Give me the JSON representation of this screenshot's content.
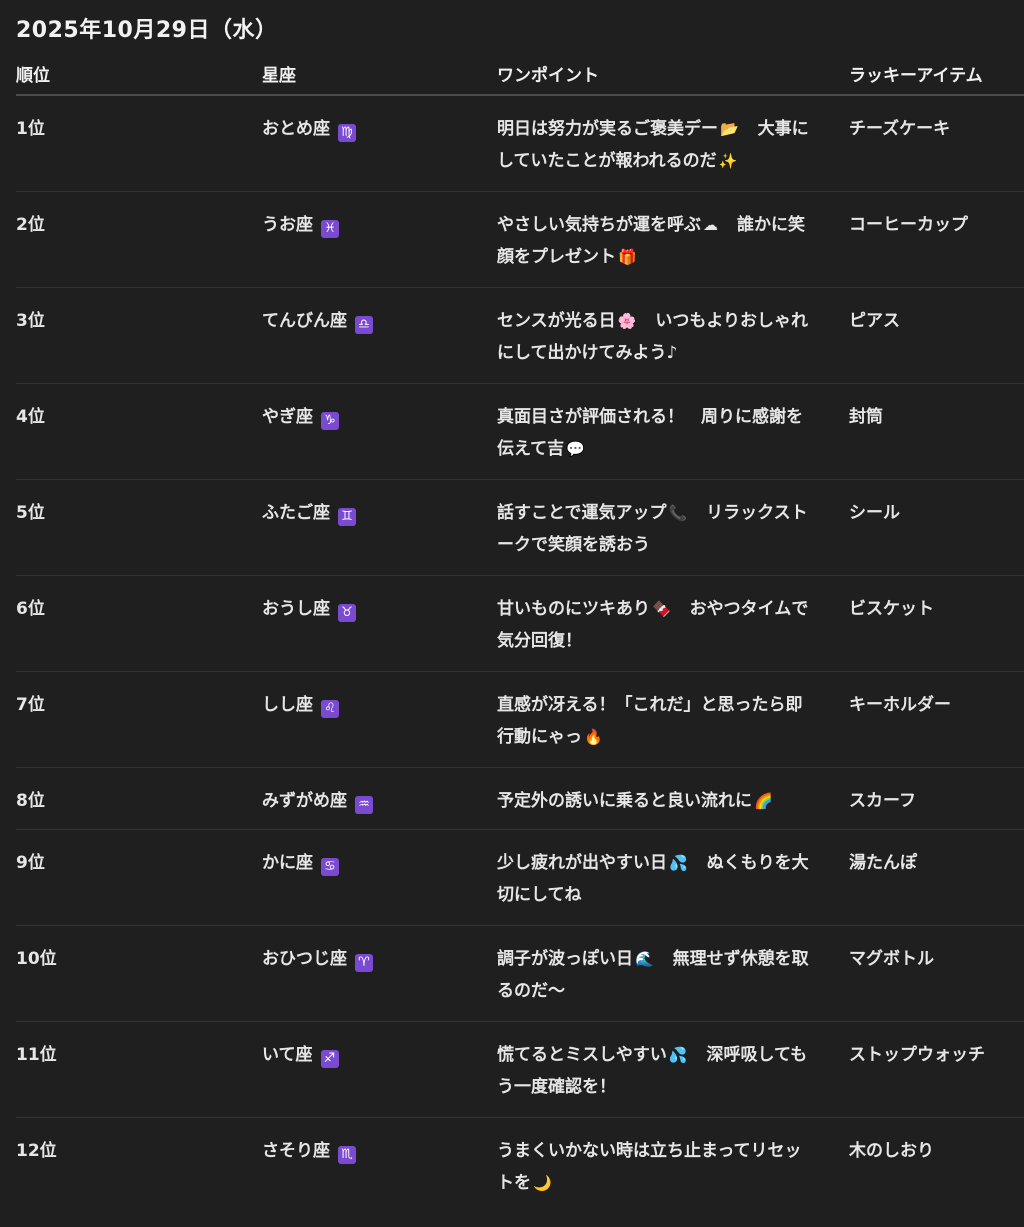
{
  "title": "2025年10月29日（水）",
  "headers": {
    "rank": "順位",
    "sign": "星座",
    "point": "ワンポイント",
    "item": "ラッキーアイテム"
  },
  "rows": [
    {
      "rank": "1位",
      "sign": "おとめ座",
      "symbol": "♍",
      "point_a": "明日は努力が実るご褒美デー",
      "emoji_a": "📂",
      "point_b": "　大事にしていたことが報われるのだ",
      "emoji_b": "✨",
      "item": "チーズケーキ"
    },
    {
      "rank": "2位",
      "sign": "うお座",
      "symbol": "♓",
      "point_a": "やさしい気持ちが運を呼ぶ",
      "emoji_a": "☁",
      "point_b": "　誰かに笑顔をプレゼント",
      "emoji_b": "🎁",
      "item": "コーヒーカップ"
    },
    {
      "rank": "3位",
      "sign": "てんびん座",
      "symbol": "♎",
      "point_a": "センスが光る日",
      "emoji_a": "🌸",
      "point_b": "　いつもよりおしゃれにして出かけてみよう♪",
      "emoji_b": "",
      "item": "ピアス"
    },
    {
      "rank": "4位",
      "sign": "やぎ座",
      "symbol": "♑",
      "point_a": "真面目さが評価される！　周りに感謝を伝えて吉",
      "emoji_a": "💬",
      "point_b": "",
      "emoji_b": "",
      "item": "封筒"
    },
    {
      "rank": "5位",
      "sign": "ふたご座",
      "symbol": "♊",
      "point_a": "話すことで運気アップ",
      "emoji_a": "📞",
      "point_b": "　リラックストークで笑顔を誘おう",
      "emoji_b": "",
      "item": "シール"
    },
    {
      "rank": "6位",
      "sign": "おうし座",
      "symbol": "♉",
      "point_a": "甘いものにツキあり",
      "emoji_a": "🍫",
      "point_b": "　おやつタイムで気分回復！",
      "emoji_b": "",
      "item": "ビスケット"
    },
    {
      "rank": "7位",
      "sign": "しし座",
      "symbol": "♌",
      "point_a": "直感が冴える！「これだ」と思ったら即行動にゃっ",
      "emoji_a": "🔥",
      "point_b": "",
      "emoji_b": "",
      "item": "キーホルダー"
    },
    {
      "rank": "8位",
      "sign": "みずがめ座",
      "symbol": "♒",
      "point_a": "予定外の誘いに乗ると良い流れに",
      "emoji_a": "🌈",
      "point_b": "",
      "emoji_b": "",
      "item": "スカーフ"
    },
    {
      "rank": "9位",
      "sign": "かに座",
      "symbol": "♋",
      "point_a": "少し疲れが出やすい日",
      "emoji_a": "💦",
      "point_b": "　ぬくもりを大切にしてね",
      "emoji_b": "",
      "item": "湯たんぽ"
    },
    {
      "rank": "10位",
      "sign": "おひつじ座",
      "symbol": "♈",
      "point_a": "調子が波っぽい日",
      "emoji_a": "🌊",
      "point_b": "　無理せず休憩を取るのだ〜",
      "emoji_b": "",
      "item": "マグボトル"
    },
    {
      "rank": "11位",
      "sign": "いて座",
      "symbol": "♐",
      "point_a": "慌てるとミスしやすい",
      "emoji_a": "💦",
      "point_b": "　深呼吸してもう一度確認を！",
      "emoji_b": "",
      "item": "ストップウォッチ"
    },
    {
      "rank": "12位",
      "sign": "さそり座",
      "symbol": "♏",
      "point_a": "うまくいかない時は立ち止まってリセットを",
      "emoji_a": "🌙",
      "point_b": "",
      "emoji_b": "",
      "item": "木のしおり"
    }
  ]
}
